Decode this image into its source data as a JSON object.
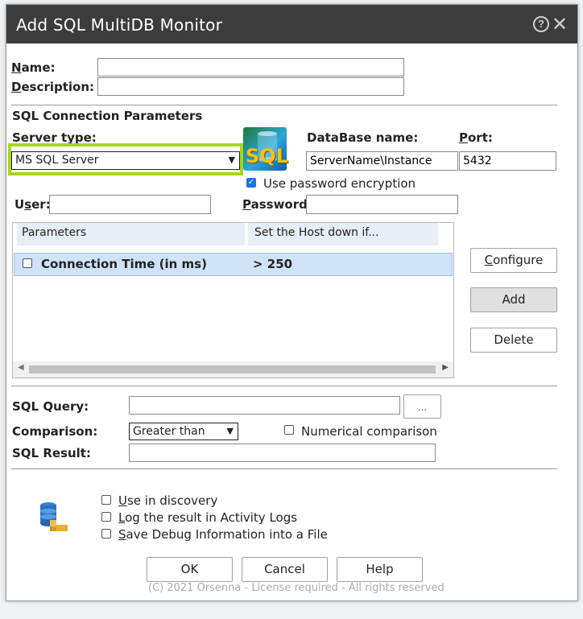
{
  "dialog": {
    "title": "Add SQL MultiDB Monitor",
    "help_glyph": "?",
    "close_glyph": "✕"
  },
  "form": {
    "name_label": "Name:",
    "name_value": "",
    "description_label": "Description:",
    "description_value": "",
    "section_title": "SQL Connection Parameters",
    "server_type_label": "Server type:",
    "server_type_value": "MS SQL Server",
    "sql_logo_text": "SQL",
    "database_name_label": "DataBase name:",
    "database_name_value": "ServerName\\Instance",
    "port_label": "Port:",
    "port_value": "5432",
    "use_password_encryption_label": "Use password encryption",
    "use_password_encryption_checked": true,
    "user_label": "User:",
    "user_value": "",
    "password_label": "Password:",
    "password_value": ""
  },
  "grid": {
    "columns": [
      "Parameters",
      "Set the Host down if..."
    ],
    "rows": [
      {
        "parameter": "Connection Time (in ms)",
        "condition": "> 250",
        "checked": false
      }
    ]
  },
  "side_buttons": {
    "configure": "Configure",
    "add": "Add",
    "delete": "Delete"
  },
  "query": {
    "sql_query_label": "SQL Query:",
    "sql_query_value": "",
    "browse_button": "...",
    "comparison_label": "Comparison:",
    "comparison_value": "Greater than",
    "numerical_comparison_label": "Numerical comparison",
    "numerical_comparison_checked": false,
    "sql_result_label": "SQL Result:",
    "sql_result_value": ""
  },
  "options": {
    "use_in_discovery": "Use in discovery",
    "log_result": "Log the result in Activity Logs",
    "save_debug": "Save Debug Information into a File"
  },
  "buttons": {
    "ok": "OK",
    "cancel": "Cancel",
    "help": "Help"
  },
  "footer_text": "(C) 2021 Orsenna - License required - All rights reserved",
  "colors": {
    "titlebar": "#3c3c3c",
    "highlight_border": "#a6d61e",
    "selected_row": "#cfe2f7",
    "checkbox_on": "#1a73e8"
  }
}
